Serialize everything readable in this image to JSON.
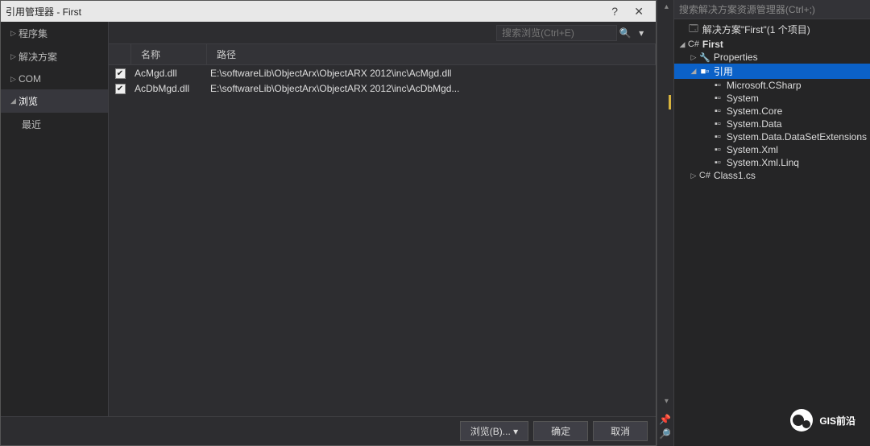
{
  "dialog": {
    "title": "引用管理器 - First",
    "help_icon": "?",
    "close_icon": "✕",
    "sidebar": {
      "items": [
        {
          "label": "程序集",
          "arrow": "▷",
          "sub": false
        },
        {
          "label": "解决方案",
          "arrow": "▷",
          "sub": false
        },
        {
          "label": "COM",
          "arrow": "▷",
          "sub": false
        },
        {
          "label": "浏览",
          "arrow": "◢",
          "sub": false,
          "selected": true
        },
        {
          "label": "最近",
          "arrow": "",
          "sub": true
        }
      ]
    },
    "search": {
      "placeholder": "搜索浏览(Ctrl+E)",
      "icon": "🔍",
      "dropdown": "▾"
    },
    "list": {
      "header": {
        "name": "名称",
        "path": "路径"
      },
      "rows": [
        {
          "checked": true,
          "name": "AcMgd.dll",
          "path": "E:\\softwareLib\\ObjectArx\\ObjectARX 2012\\inc\\AcMgd.dll"
        },
        {
          "checked": true,
          "name": "AcDbMgd.dll",
          "path": "E:\\softwareLib\\ObjectArx\\ObjectARX 2012\\inc\\AcDbMgd..."
        }
      ]
    },
    "footer": {
      "browse": "浏览(B)...",
      "ok": "确定",
      "cancel": "取消",
      "browse_dropdown": "▾"
    }
  },
  "explorer": {
    "search_placeholder": "搜索解决方案资源管理器(Ctrl+;)",
    "tree": [
      {
        "indent": 0,
        "arrow": "",
        "icon": "🗔",
        "label": "解决方案\"First\"(1 个项目)",
        "bold": false
      },
      {
        "indent": 0,
        "arrow": "◢",
        "icon": "C#",
        "label": "First",
        "bold": true
      },
      {
        "indent": 1,
        "arrow": "▷",
        "icon": "🔧",
        "label": "Properties"
      },
      {
        "indent": 1,
        "arrow": "◢",
        "icon": "■▫",
        "label": "引用",
        "selected": true
      },
      {
        "indent": 2,
        "arrow": "",
        "icon": "▪▫",
        "label": "Microsoft.CSharp"
      },
      {
        "indent": 2,
        "arrow": "",
        "icon": "▪▫",
        "label": "System"
      },
      {
        "indent": 2,
        "arrow": "",
        "icon": "▪▫",
        "label": "System.Core"
      },
      {
        "indent": 2,
        "arrow": "",
        "icon": "▪▫",
        "label": "System.Data"
      },
      {
        "indent": 2,
        "arrow": "",
        "icon": "▪▫",
        "label": "System.Data.DataSetExtensions"
      },
      {
        "indent": 2,
        "arrow": "",
        "icon": "▪▫",
        "label": "System.Xml"
      },
      {
        "indent": 2,
        "arrow": "",
        "icon": "▪▫",
        "label": "System.Xml.Linq"
      },
      {
        "indent": 1,
        "arrow": "▷",
        "icon": "C#",
        "label": "Class1.cs"
      }
    ]
  },
  "gutter": {
    "pin_icon": "📌",
    "search_icon": "🔎"
  },
  "watermark": {
    "text": "GIS前沿"
  }
}
